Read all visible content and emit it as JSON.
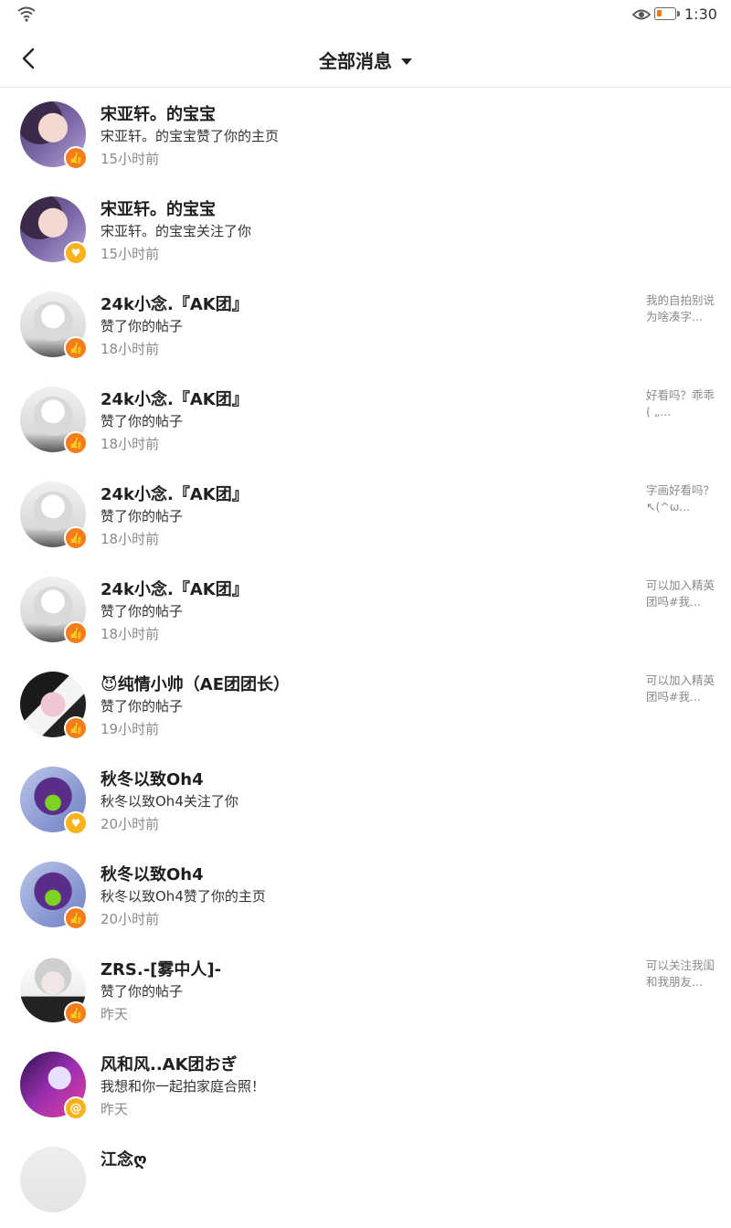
{
  "status_bar": {
    "time": "1:30",
    "wifi_icon": "wifi-icon",
    "eye_icon": "eye-icon",
    "battery_icon": "battery-icon",
    "battery_level": 0.2
  },
  "header": {
    "title": "全部消息",
    "back_icon": "chevron-left-icon",
    "dropdown_icon": "caret-down-icon"
  },
  "colors": {
    "like_badge": "#f47c1a",
    "follow_badge": "#f7b21c",
    "divider": "#e9e9e9",
    "muted_text": "#8a8a8a"
  },
  "messages": [
    {
      "name": "宋亚轩。的宝宝",
      "text": "宋亚轩。的宝宝赞了你的主页",
      "time": "15小时前",
      "preview": "",
      "badge": "thumbs-up-icon",
      "badge_glyph": "👍",
      "avatar": "avatar"
    },
    {
      "name": "宋亚轩。的宝宝",
      "text": "宋亚轩。的宝宝关注了你",
      "time": "15小时前",
      "preview": "",
      "badge": "heart-icon",
      "badge_glyph": "♥",
      "avatar": "avatar"
    },
    {
      "name": "24k小念.『AK团』",
      "text": "赞了你的帖子",
      "time": "18小时前",
      "preview": "我的自拍别说为啥凑字...",
      "badge": "thumbs-up-icon",
      "badge_glyph": "👍",
      "avatar": "avatar"
    },
    {
      "name": "24k小念.『AK团』",
      "text": "赞了你的帖子",
      "time": "18小时前",
      "preview": "好看吗？乖乖( „...",
      "badge": "thumbs-up-icon",
      "badge_glyph": "👍",
      "avatar": "avatar"
    },
    {
      "name": "24k小念.『AK团』",
      "text": "赞了你的帖子",
      "time": "18小时前",
      "preview": "字画好看吗？↖(^ω...",
      "badge": "thumbs-up-icon",
      "badge_glyph": "👍",
      "avatar": "avatar"
    },
    {
      "name": "24k小念.『AK团』",
      "text": "赞了你的帖子",
      "time": "18小时前",
      "preview": "可以加入精英团吗#我...",
      "badge": "thumbs-up-icon",
      "badge_glyph": "👍",
      "avatar": "avatar"
    },
    {
      "name": "😈纯情小帅（AE团团长）",
      "text": "赞了你的帖子",
      "time": "19小时前",
      "preview": "可以加入精英团吗#我...",
      "badge": "thumbs-up-icon",
      "badge_glyph": "👍",
      "avatar": "avatar"
    },
    {
      "name": "秋冬以致Oh4",
      "text": "秋冬以致Oh4关注了你",
      "time": "20小时前",
      "preview": "",
      "badge": "heart-icon",
      "badge_glyph": "♥",
      "avatar": "avatar"
    },
    {
      "name": "秋冬以致Oh4",
      "text": "秋冬以致Oh4赞了你的主页",
      "time": "20小时前",
      "preview": "",
      "badge": "thumbs-up-icon",
      "badge_glyph": "👍",
      "avatar": "avatar"
    },
    {
      "name": "ZRS.-[雾中人]-",
      "text": "赞了你的帖子",
      "time": "昨天",
      "preview": "可以关注我闺和我朋友...",
      "badge": "thumbs-up-icon",
      "badge_glyph": "👍",
      "avatar": "avatar"
    },
    {
      "name": "风和风..AK团おぎ",
      "text": "我想和你一起拍家庭合照！",
      "time": "昨天",
      "preview": "",
      "badge": "at-icon",
      "badge_glyph": "@",
      "avatar": "avatar"
    },
    {
      "name": "江念ღ",
      "text": "",
      "time": "",
      "preview": "",
      "badge": "",
      "badge_glyph": "",
      "avatar": "avatar"
    }
  ]
}
